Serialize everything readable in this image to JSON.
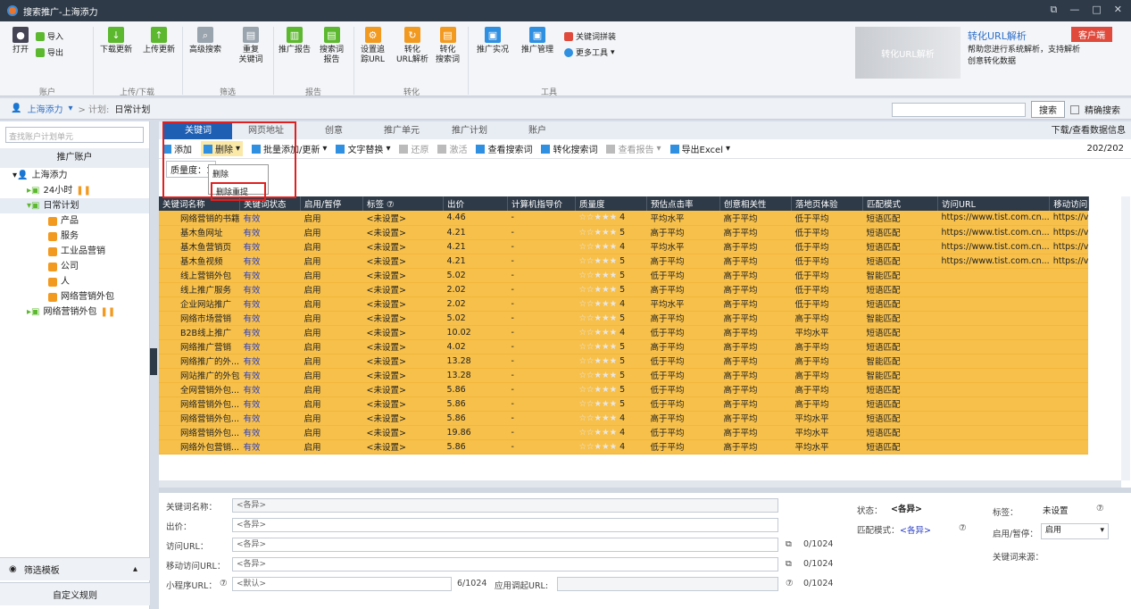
{
  "window": {
    "title": "搜索推广-上海添力"
  },
  "ribbon": {
    "import": "导入",
    "export": "导出",
    "open": "打开",
    "download_update": "下载更新",
    "upload_update": "上传更新",
    "advanced_search": "高级搜索",
    "duplicate_keywords": "重复\n关键词",
    "promo_report": "推广报告",
    "search_report": "搜索词\n报告",
    "track_url": "设置追\n踪URL",
    "conv_url": "转化\nURL解析",
    "conv_search": "转化\n搜索词",
    "live_view": "推广实况",
    "promo_manage": "推广管理",
    "kw_plan": "关键词拼装",
    "more_tools": "更多工具",
    "groups": [
      "账户",
      "上传/下载",
      "筛选",
      "报告",
      "转化",
      "工具"
    ],
    "promo_banner": "转化URL解析",
    "promo_title": "转化URL解析",
    "promo_badge": "客户端",
    "promo_desc": "帮助您进行系统解析，支持解析创意转化数据"
  },
  "crumb": {
    "account": "上海添力",
    "sep": "> 计划:",
    "plan": "日常计划",
    "search_btn": "搜索",
    "exact": "精确搜索"
  },
  "sidebar": {
    "search_placeholder": "查找账户计划单元",
    "header": "推广账户",
    "root": "上海添力",
    "items": [
      "24小时",
      "日常计划",
      "产品",
      "服务",
      "工业品营销",
      "公司",
      "人",
      "网络营销外包",
      "网络营销外包"
    ],
    "filter": "筛选模板",
    "custom": "自定义规则"
  },
  "tabs": [
    "关键词",
    "网页地址",
    "创意",
    "推广单元",
    "推广计划",
    "账户"
  ],
  "tabs_right": "下载/查看数据信息",
  "toolbar": {
    "add": "添加",
    "delete": "删除",
    "batch": "批量添加/更新",
    "replace": "文字替换",
    "restore": "还原",
    "activate": "激活",
    "view_search": "查看搜索词",
    "conv_search": "转化搜索词",
    "view_report": "查看报告",
    "export": "导出Excel",
    "count": "202/202"
  },
  "popup": {
    "item1": "删除",
    "item2": "删除重提"
  },
  "quality_label": "质量度：1",
  "columns": [
    "关键词名称",
    "关键词状态",
    "启用/暂停",
    "标签 ⑦",
    "出价",
    "计算机指导价",
    "质量度",
    "预估点击率",
    "创意相关性",
    "落地页体验",
    "匹配模式",
    "访问URL",
    "移动访问"
  ],
  "rows": [
    [
      "网络营销的书籍",
      "有效",
      "启用",
      "<未设置>",
      "4.46",
      "-",
      "4",
      "平均水平",
      "高于平均",
      "低于平均",
      "短语匹配",
      "https://www.tist.com.cn...",
      "https://v"
    ],
    [
      "基木鱼网址",
      "有效",
      "启用",
      "<未设置>",
      "4.21",
      "-",
      "5",
      "高于平均",
      "高于平均",
      "低于平均",
      "短语匹配",
      "https://www.tist.com.cn...",
      "https://v"
    ],
    [
      "基木鱼营销页",
      "有效",
      "启用",
      "<未设置>",
      "4.21",
      "-",
      "4",
      "平均水平",
      "高于平均",
      "低于平均",
      "短语匹配",
      "https://www.tist.com.cn...",
      "https://v"
    ],
    [
      "基木鱼视频",
      "有效",
      "启用",
      "<未设置>",
      "4.21",
      "-",
      "5",
      "高于平均",
      "高于平均",
      "低于平均",
      "短语匹配",
      "https://www.tist.com.cn...",
      "https://v"
    ],
    [
      "线上营销外包",
      "有效",
      "启用",
      "<未设置>",
      "5.02",
      "-",
      "5",
      "低于平均",
      "高于平均",
      "低于平均",
      "智能匹配",
      "",
      ""
    ],
    [
      "线上推广服务",
      "有效",
      "启用",
      "<未设置>",
      "2.02",
      "-",
      "5",
      "高于平均",
      "高于平均",
      "低于平均",
      "短语匹配",
      "",
      ""
    ],
    [
      "企业网站推广",
      "有效",
      "启用",
      "<未设置>",
      "2.02",
      "-",
      "4",
      "平均水平",
      "高于平均",
      "低于平均",
      "短语匹配",
      "",
      ""
    ],
    [
      "网络市场营销",
      "有效",
      "启用",
      "<未设置>",
      "5.02",
      "-",
      "5",
      "高于平均",
      "高于平均",
      "高于平均",
      "智能匹配",
      "",
      ""
    ],
    [
      "B2B线上推广",
      "有效",
      "启用",
      "<未设置>",
      "10.02",
      "-",
      "4",
      "低于平均",
      "高于平均",
      "平均水平",
      "短语匹配",
      "",
      ""
    ],
    [
      "网络推广营销",
      "有效",
      "启用",
      "<未设置>",
      "4.02",
      "-",
      "5",
      "高于平均",
      "高于平均",
      "高于平均",
      "短语匹配",
      "",
      ""
    ],
    [
      "网络推广的外...",
      "有效",
      "启用",
      "<未设置>",
      "13.28",
      "-",
      "5",
      "低于平均",
      "高于平均",
      "高于平均",
      "智能匹配",
      "",
      ""
    ],
    [
      "网站推广的外包",
      "有效",
      "启用",
      "<未设置>",
      "13.28",
      "-",
      "5",
      "低于平均",
      "高于平均",
      "高于平均",
      "智能匹配",
      "",
      ""
    ],
    [
      "全网营销外包...",
      "有效",
      "启用",
      "<未设置>",
      "5.86",
      "-",
      "5",
      "低于平均",
      "高于平均",
      "高于平均",
      "短语匹配",
      "",
      ""
    ],
    [
      "网络营销外包...",
      "有效",
      "启用",
      "<未设置>",
      "5.86",
      "-",
      "5",
      "低于平均",
      "高于平均",
      "高于平均",
      "短语匹配",
      "",
      ""
    ],
    [
      "网络营销外包...",
      "有效",
      "启用",
      "<未设置>",
      "5.86",
      "-",
      "4",
      "高于平均",
      "高于平均",
      "平均水平",
      "短语匹配",
      "",
      ""
    ],
    [
      "网络营销外包...",
      "有效",
      "启用",
      "<未设置>",
      "19.86",
      "-",
      "4",
      "低于平均",
      "高于平均",
      "平均水平",
      "短语匹配",
      "",
      ""
    ],
    [
      "网络外包营销...",
      "有效",
      "启用",
      "<未设置>",
      "5.86",
      "-",
      "4",
      "低于平均",
      "高于平均",
      "平均水平",
      "短语匹配",
      "",
      ""
    ]
  ],
  "detail": {
    "kw_name": "关键词名称：",
    "bid": "出价：",
    "url": "访问URL：",
    "murl": "移动访问URL：",
    "mini": "小程序URL：",
    "various": "<各异>",
    "default": "<默认>",
    "count1": "0/1024",
    "count2": "0/1024",
    "count3": "0/1024",
    "count4": "6/1024",
    "app_url": "应用调起URL:",
    "status": "状态：",
    "status_val": "<各异>",
    "match": "匹配模式：",
    "match_val": "<各异>",
    "tag": "标签：",
    "tag_val": "未设置",
    "enable": "启用/暂停：",
    "enable_val": "启用",
    "source": "关键词来源："
  }
}
